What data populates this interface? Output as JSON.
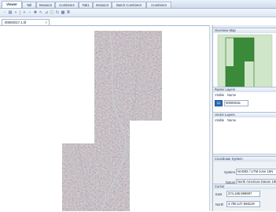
{
  "tabs": [
    {
      "label": "Viewer",
      "active": true
    },
    {
      "label": "Tall",
      "active": false
    },
    {
      "label": "Mosaic2",
      "active": false
    },
    {
      "label": "Combine2",
      "active": false
    },
    {
      "label": "Tab1",
      "active": false
    },
    {
      "label": "Mosaic3",
      "active": false
    },
    {
      "label": "Batch Combine3",
      "active": false
    },
    {
      "label": "Combine3",
      "active": false
    }
  ],
  "toolbar_icons": [
    "new-icon",
    "open-icon",
    "save-icon",
    "zoom-in-icon",
    "zoom-out-icon",
    "pan-icon",
    "select-icon",
    "measure-icon",
    "identify-icon",
    "refresh-icon",
    "grid-icon",
    "layers-icon"
  ],
  "document_tab": {
    "label": "00000017.1.tif",
    "close": "×"
  },
  "overview_map": {
    "title": "Overview Map"
  },
  "raster_layers": {
    "title": "Raster Layers",
    "col_visible": "Visible",
    "col_name": "Name",
    "row_value": "00000015"
  },
  "vector_layers": {
    "title": "Vector Layers",
    "col_visible": "Visible",
    "col_name": "Name"
  },
  "coordinate_system": {
    "title": "Coordinate System",
    "system_label": "System",
    "system_value": "NAD83 / UTM zone 16N",
    "datum_label": "Datum",
    "datum_value": "North American Datum 1983",
    "units_label": "Units",
    "units_value": "Meter (m)"
  },
  "cursor": {
    "title": "Cursor",
    "east_label": "East",
    "east_value": "374,186.899997",
    "north_label": "North",
    "north_value": "3,780,147.658129"
  },
  "colors": {
    "tab_active": "#ffffff",
    "panel_bg": "#e4ebf4",
    "accent": "#2f6fbd",
    "overview_green": "#3a8a3a"
  }
}
